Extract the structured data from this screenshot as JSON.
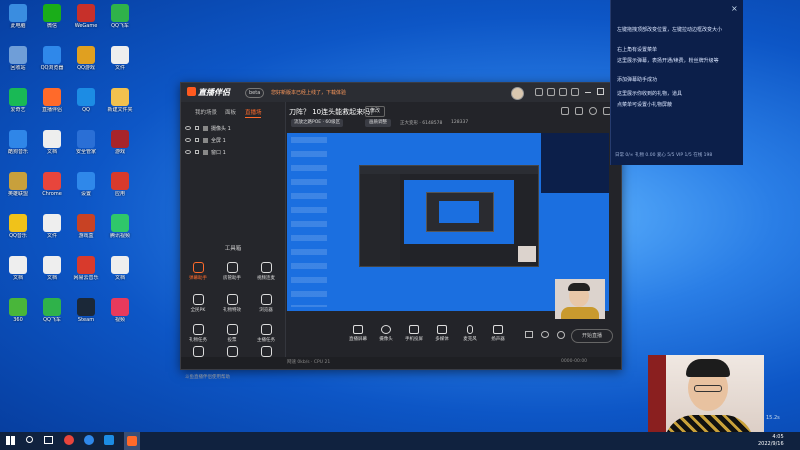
{
  "desktop": {
    "icons": [
      {
        "label": "此电脑",
        "color": "#3a8de0"
      },
      {
        "label": "微信",
        "color": "#1aad19"
      },
      {
        "label": "WeGame",
        "color": "#c7302a"
      },
      {
        "label": "QQ飞车",
        "color": "#2fb24a"
      },
      {
        "label": "回收站",
        "color": "#6f9ed8"
      },
      {
        "label": "QQ浏览器",
        "color": "#2f88ea"
      },
      {
        "label": "QQ游戏",
        "color": "#e0a020"
      },
      {
        "label": "文件",
        "color": "#eeeeee"
      },
      {
        "label": "爱奇艺",
        "color": "#19b955"
      },
      {
        "label": "直播伴侣",
        "color": "#ff6a2a"
      },
      {
        "label": "QQ",
        "color": "#1c8ce4"
      },
      {
        "label": "新建文件夹",
        "color": "#f2c14e"
      },
      {
        "label": "酷狗音乐",
        "color": "#2f86e8"
      },
      {
        "label": "文档",
        "color": "#eeeeee"
      },
      {
        "label": "安全管家",
        "color": "#2a6fd6"
      },
      {
        "label": "游戏",
        "color": "#a8242a"
      },
      {
        "label": "英雄联盟",
        "color": "#c8a03c"
      },
      {
        "label": "Chrome",
        "color": "#e8453c"
      },
      {
        "label": "设置",
        "color": "#2f88ea"
      },
      {
        "label": "应用",
        "color": "#d83a2c"
      },
      {
        "label": "QQ音乐",
        "color": "#f0c21a"
      },
      {
        "label": "文件",
        "color": "#eeeeee"
      },
      {
        "label": "游戏盒",
        "color": "#c84224"
      },
      {
        "label": "腾讯视频",
        "color": "#2fc76a"
      },
      {
        "label": "文档",
        "color": "#eeeeee"
      },
      {
        "label": "文档",
        "color": "#eeeeee"
      },
      {
        "label": "网易云音乐",
        "color": "#d83a2c"
      },
      {
        "label": "文档",
        "color": "#eeeeee"
      },
      {
        "label": "360",
        "color": "#49b63a"
      },
      {
        "label": "QQ飞车",
        "color": "#2fb24a"
      },
      {
        "label": "Steam",
        "color": "#1b2838"
      },
      {
        "label": "视频",
        "color": "#e83a5c"
      }
    ]
  },
  "window": {
    "app_name": "直播伴侣",
    "version_badge": "beta",
    "notice": "您好新版本已经上线了，下载体验",
    "left_tabs": [
      "我的场景",
      "面板",
      "直播场"
    ],
    "sources": [
      {
        "label": "摄像头 1"
      },
      {
        "label": "全屏 1"
      },
      {
        "label": "窗口 1"
      }
    ],
    "tools_title": "工具箱",
    "tools": [
      {
        "label": "弹幕助手",
        "hot": true
      },
      {
        "label": "房管助手",
        "hot": false
      },
      {
        "label": "视频连麦",
        "hot": false
      },
      {
        "label": "全民PK",
        "hot": false
      },
      {
        "label": "礼物特效",
        "hot": false
      },
      {
        "label": "浏览器",
        "hot": false
      },
      {
        "label": "礼物任务",
        "hot": false
      },
      {
        "label": "投票",
        "hot": false
      },
      {
        "label": "主播任务",
        "hot": false
      },
      {
        "label": "",
        "hot": false
      },
      {
        "label": "",
        "hot": false
      },
      {
        "label": "",
        "hot": false
      }
    ],
    "left_bottom_note": "斗鱼直播伴侣使用帮助",
    "stream_title": "刀阵？ 10连头能救起来吗？",
    "edit_label": "修改",
    "category": "流放之路POE · 60级区",
    "quality_label": "画质调整",
    "room_info": "正大变形 · 6148578",
    "fans_count": "128337",
    "controls": [
      {
        "label": "直播屏幕"
      },
      {
        "label": "摄像头"
      },
      {
        "label": "手机投屏"
      },
      {
        "label": "多媒体"
      },
      {
        "label": "麦克风"
      },
      {
        "label": "扬声器"
      }
    ],
    "start_live_label": "开始直播",
    "status_left": "网速 0kb/s · CPU 21",
    "status_right": "0000-00:00"
  },
  "side_panel": {
    "hints": [
      "左键拖拽顶部改变位置，左键拉动边框改变大小",
      "右上角有设置菜单",
      "这里展示弹幕，表扬开通/续费，粉丝牌升级等",
      "添加弹幕助手成功",
      "这里展示你收到的礼物，道具",
      "点菜单可设置小礼物屏蔽"
    ],
    "stats": "日常 0/∞   礼物 0.00   爱心 5/5   VIP 1/5   在线 198"
  },
  "side_timer": "15.2s",
  "taskbar": {
    "time": "4:05",
    "date": "2022/9/16"
  },
  "colors": {
    "accent": "#ff6a2a",
    "window_bg": "#232429",
    "desktop": "#1b6fe0"
  }
}
